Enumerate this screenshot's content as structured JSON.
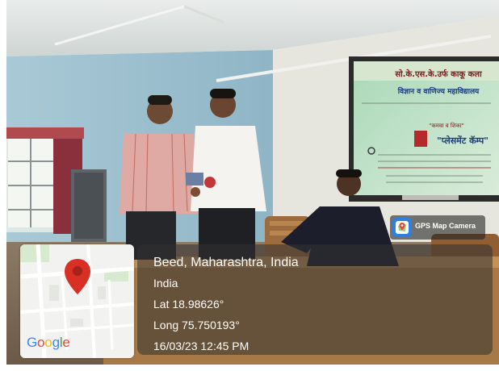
{
  "photo": {
    "projector_slide": {
      "college_name": "सो.के.एस.के.उर्फ काकू कला",
      "college_subtitle": "विज्ञान व वाणिज्य महाविद्यालय",
      "event_label": "\"कमवा व शिका\"",
      "event_title": "\"प्लेसमेंट कॅम्प\""
    }
  },
  "gps_badge": {
    "icon": "map-pin-camera-icon",
    "label": "GPS Map Camera"
  },
  "map": {
    "brand": "Google",
    "marker_icon": "map-marker-icon",
    "marker_color": "#d93025"
  },
  "location": {
    "place": "Beed, Maharashtra, India",
    "country": "India",
    "lat": "Lat 18.98626°",
    "long": "Long 75.750193°",
    "datetime": "16/03/23 12:45 PM"
  }
}
